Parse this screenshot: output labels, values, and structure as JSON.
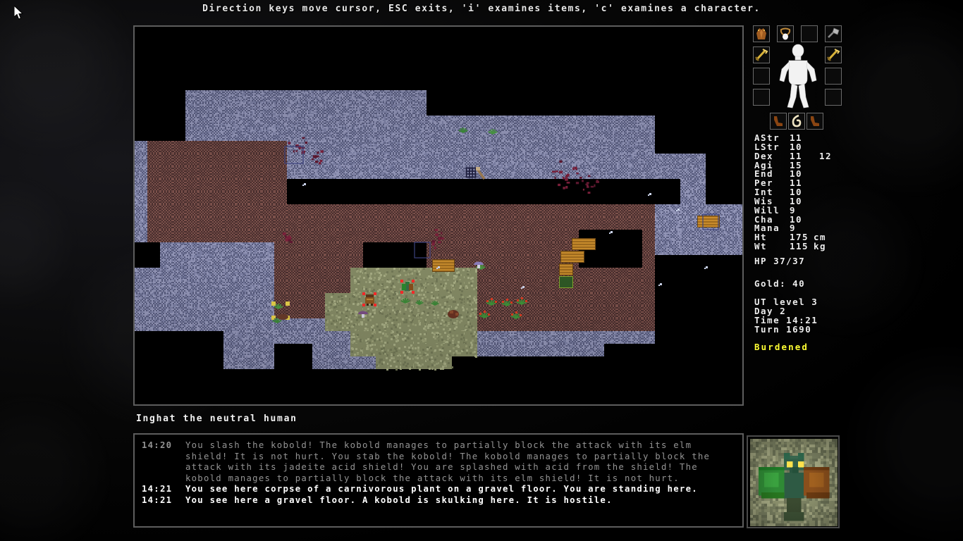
{
  "hint_bar": {
    "text": "Direction keys move cursor, ESC exits, 'i' examines items, 'c' examines a character."
  },
  "character": {
    "title_line": "Inghat the neutral human"
  },
  "equipment": {
    "slots": [
      {
        "name": "cloak-slot",
        "item": "brown cloak",
        "filled": true
      },
      {
        "name": "amulet-slot",
        "item": "amulet",
        "filled": true
      },
      {
        "name": "head-slot",
        "item": "",
        "filled": false
      },
      {
        "name": "weapon-tool-slot",
        "item": "gray axe",
        "filled": true
      },
      {
        "name": "left-hand-slot",
        "item": "gold sword",
        "filled": true
      },
      {
        "name": "left-ring-slot",
        "item": "",
        "filled": false
      },
      {
        "name": "left-misc-slot",
        "item": "",
        "filled": false
      },
      {
        "name": "right-hand-slot",
        "item": "gold sword",
        "filled": true
      },
      {
        "name": "right-ring-slot",
        "item": "",
        "filled": false
      },
      {
        "name": "right-misc-slot",
        "item": "",
        "filled": false
      },
      {
        "name": "left-boot-slot",
        "item": "brown boot",
        "filled": true
      },
      {
        "name": "center-item-slot",
        "item": "cream horn",
        "filled": true
      },
      {
        "name": "right-boot-slot",
        "item": "brown boot",
        "filled": true
      }
    ]
  },
  "stats": {
    "rows": [
      {
        "key": "AStr",
        "value": "11",
        "unit": "",
        "extra": ""
      },
      {
        "key": "LStr",
        "value": "10",
        "unit": "",
        "extra": ""
      },
      {
        "key": "Dex",
        "value": "11",
        "unit": "",
        "extra": "12"
      },
      {
        "key": "Agi",
        "value": "15",
        "unit": "",
        "extra": ""
      },
      {
        "key": "End",
        "value": "10",
        "unit": "",
        "extra": ""
      },
      {
        "key": "Per",
        "value": "11",
        "unit": "",
        "extra": ""
      },
      {
        "key": "Int",
        "value": "10",
        "unit": "",
        "extra": ""
      },
      {
        "key": "Wis",
        "value": "10",
        "unit": "",
        "extra": ""
      },
      {
        "key": "Will",
        "value": "9",
        "unit": "",
        "extra": ""
      },
      {
        "key": "Cha",
        "value": "10",
        "unit": "",
        "extra": ""
      },
      {
        "key": "Mana",
        "value": "9",
        "unit": "",
        "extra": ""
      },
      {
        "key": "Ht",
        "value": "175",
        "unit": "cm",
        "extra": ""
      },
      {
        "key": "Wt",
        "value": "115",
        "unit": "kg",
        "extra": ""
      }
    ],
    "hp": "HP 37/37",
    "gold": "Gold: 40",
    "location": "UT level 3",
    "day": "Day 2",
    "time": "Time 14:21",
    "turn": "Turn 1690",
    "status": "Burdened",
    "status_color": "#ffff33"
  },
  "message_log": {
    "lines": [
      {
        "timestamp": "14:20",
        "text": "You slash the kobold! The kobold manages to partially block the attack with its elm shield! It is not hurt. You stab the kobold! The kobold manages to partially block the attack with its jadeite acid shield! You are splashed with acid from the shield! The kobold manages to partially block the attack with its elm shield! It is not hurt.",
        "style": "dim"
      },
      {
        "timestamp": "14:21",
        "text": "You see here corpse of a carnivorous plant on a gravel floor. You are standing here.",
        "style": "bright"
      },
      {
        "timestamp": "14:21",
        "text": "You see here a gravel floor. A kobold is skulking here. It is hostile.",
        "style": "bright"
      }
    ]
  },
  "portrait": {
    "subject": "kobold",
    "description": "kobold holding a green elm shield and a brown jadeite acid shield",
    "colors": {
      "background": "#8f9470",
      "body": "#3c6b52",
      "shield_green": "#2f8a35",
      "shield_brown": "#8a4f1c",
      "eyes": "#ffe34d"
    }
  },
  "map": {
    "tile_size": 18,
    "cols": 48,
    "rows": 30,
    "colors": {
      "unseen": "#000000",
      "wall": "#7b7fa3",
      "wall_dark": "#5a5e80",
      "floor_brown": "#6e4844",
      "floor_dark": "#4a2f2e",
      "gravel": "#9aa077",
      "door_wood": "#b07a28",
      "blood": "#5e1830",
      "plant": "#3f8f3a",
      "cursor": "#ff2a2a",
      "target_reticle": "#22224a",
      "item_yellow": "#e8d24a"
    },
    "cursor_tile": {
      "col": 26,
      "row": 11
    },
    "player_tile": {
      "col": 18,
      "row": 21
    },
    "kobold_tile": {
      "col": 21,
      "row": 20
    }
  }
}
